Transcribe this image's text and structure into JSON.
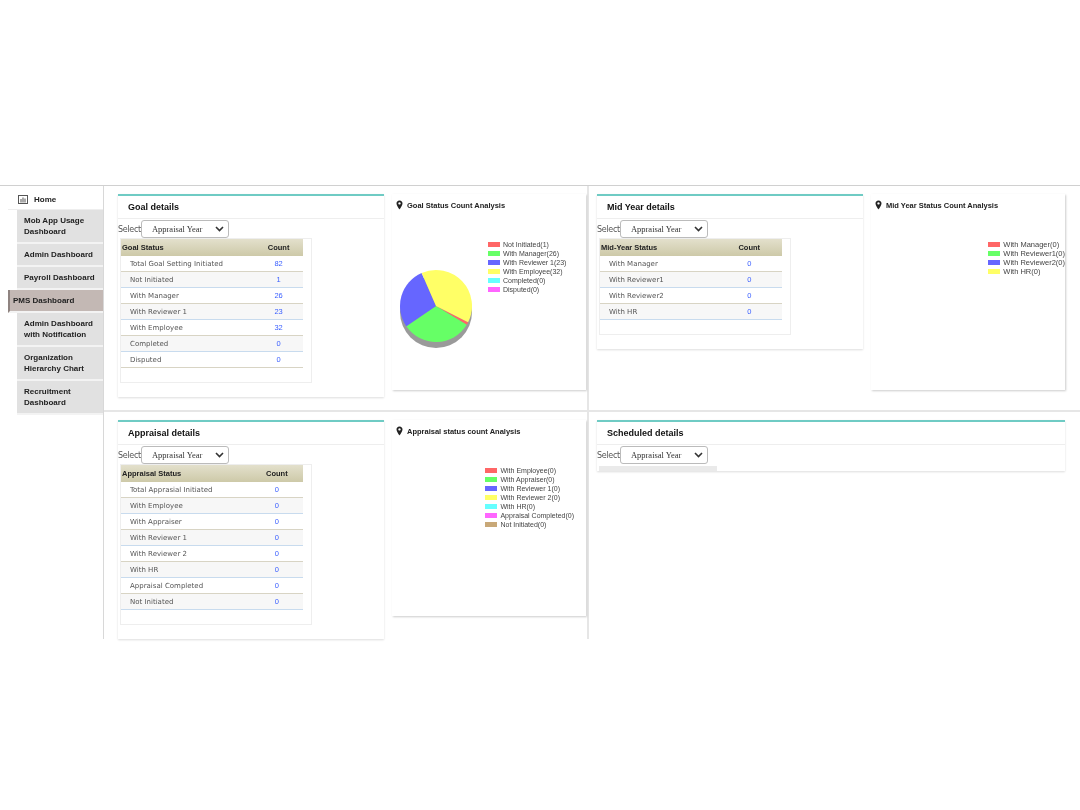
{
  "sidebar": {
    "home": {
      "label": "Home"
    },
    "items": [
      {
        "label": "Mob App Usage Dashboard",
        "selected": false
      },
      {
        "label": "Admin Dashboard",
        "selected": false
      },
      {
        "label": "Payroll Dashboard",
        "selected": false
      },
      {
        "label": "PMS Dashboard",
        "selected": true
      },
      {
        "label": "Admin Dashboard with Notification",
        "selected": false
      },
      {
        "label": "Organization Hierarchy Chart",
        "selected": false
      },
      {
        "label": "Recruitment Dashboard",
        "selected": false
      }
    ]
  },
  "sections": [
    {
      "details": {
        "title": "Goal details",
        "select_label": "Select",
        "dropdown": "Appraisal Year",
        "table": {
          "columns": [
            "Goal Status",
            "Count"
          ],
          "rows": [
            [
              "Total Goal Setting Initiated",
              "82"
            ],
            [
              "Not Initiated",
              "1"
            ],
            [
              "With Manager",
              "26"
            ],
            [
              "With Reviewer 1",
              "23"
            ],
            [
              "With Employee",
              "32"
            ],
            [
              "Completed",
              "0"
            ],
            [
              "Disputed",
              "0"
            ]
          ]
        }
      },
      "chart": {
        "title": "Goal Status Count Analysis",
        "chart_data": {
          "type": "pie",
          "categories": [
            "Not Initiated(1)",
            "With Manager(26)",
            "With Reviewer 1(23)",
            "With Employee(32)",
            "Completed(0)",
            "Disputed(0)"
          ],
          "values": [
            1,
            26,
            23,
            32,
            0,
            0
          ],
          "colors": [
            "#ff6666",
            "#66ff66",
            "#6666ff",
            "#ffff66",
            "#66ffff",
            "#ff66ff"
          ]
        }
      }
    },
    {
      "details": {
        "title": "Mid Year details",
        "select_label": "Select",
        "dropdown": "Appraisal Year",
        "table": {
          "columns": [
            "Mid-Year Status",
            "Count"
          ],
          "rows": [
            [
              "With Manager",
              "0"
            ],
            [
              "With Reviewer1",
              "0"
            ],
            [
              "With Reviewer2",
              "0"
            ],
            [
              "With HR",
              "0"
            ]
          ]
        }
      },
      "chart": {
        "title": "Mid Year Status Count Analysis",
        "legend": [
          {
            "label": "With Manager(0)",
            "color": "#ff6666"
          },
          {
            "label": "With Reviewer1(0)",
            "color": "#66ff66"
          },
          {
            "label": "With Reviewer2(0)",
            "color": "#6666ff"
          },
          {
            "label": "With HR(0)",
            "color": "#ffff66"
          }
        ]
      }
    },
    {
      "details": {
        "title": "Appraisal details",
        "select_label": "Select",
        "dropdown": "Appraisal Year",
        "table": {
          "columns": [
            "Appraisal Status",
            "Count"
          ],
          "rows": [
            [
              "Total Apprasial Initiated",
              "0"
            ],
            [
              "With Employee",
              "0"
            ],
            [
              "With Appraiser",
              "0"
            ],
            [
              "With Reviewer 1",
              "0"
            ],
            [
              "With Reviewer 2",
              "0"
            ],
            [
              "With HR",
              "0"
            ],
            [
              "Appraisal Completed",
              "0"
            ],
            [
              "Not Initiated",
              "0"
            ]
          ]
        }
      },
      "chart": {
        "title": "Appraisal status count Analysis",
        "legend": [
          {
            "label": "With Employee(0)",
            "color": "#ff6666"
          },
          {
            "label": "With Appraiser(0)",
            "color": "#66ff66"
          },
          {
            "label": "With Reviewer 1(0)",
            "color": "#6666ff"
          },
          {
            "label": "With Reviewer 2(0)",
            "color": "#ffff66"
          },
          {
            "label": "With HR(0)",
            "color": "#66ffff"
          },
          {
            "label": "Appraisal Completed(0)",
            "color": "#ff66ff"
          },
          {
            "label": "Not Initiated(0)",
            "color": "#c8a878"
          }
        ]
      }
    },
    {
      "details": {
        "title": "Scheduled details",
        "select_label": "Select",
        "dropdown": "Appraisal Year"
      }
    }
  ]
}
